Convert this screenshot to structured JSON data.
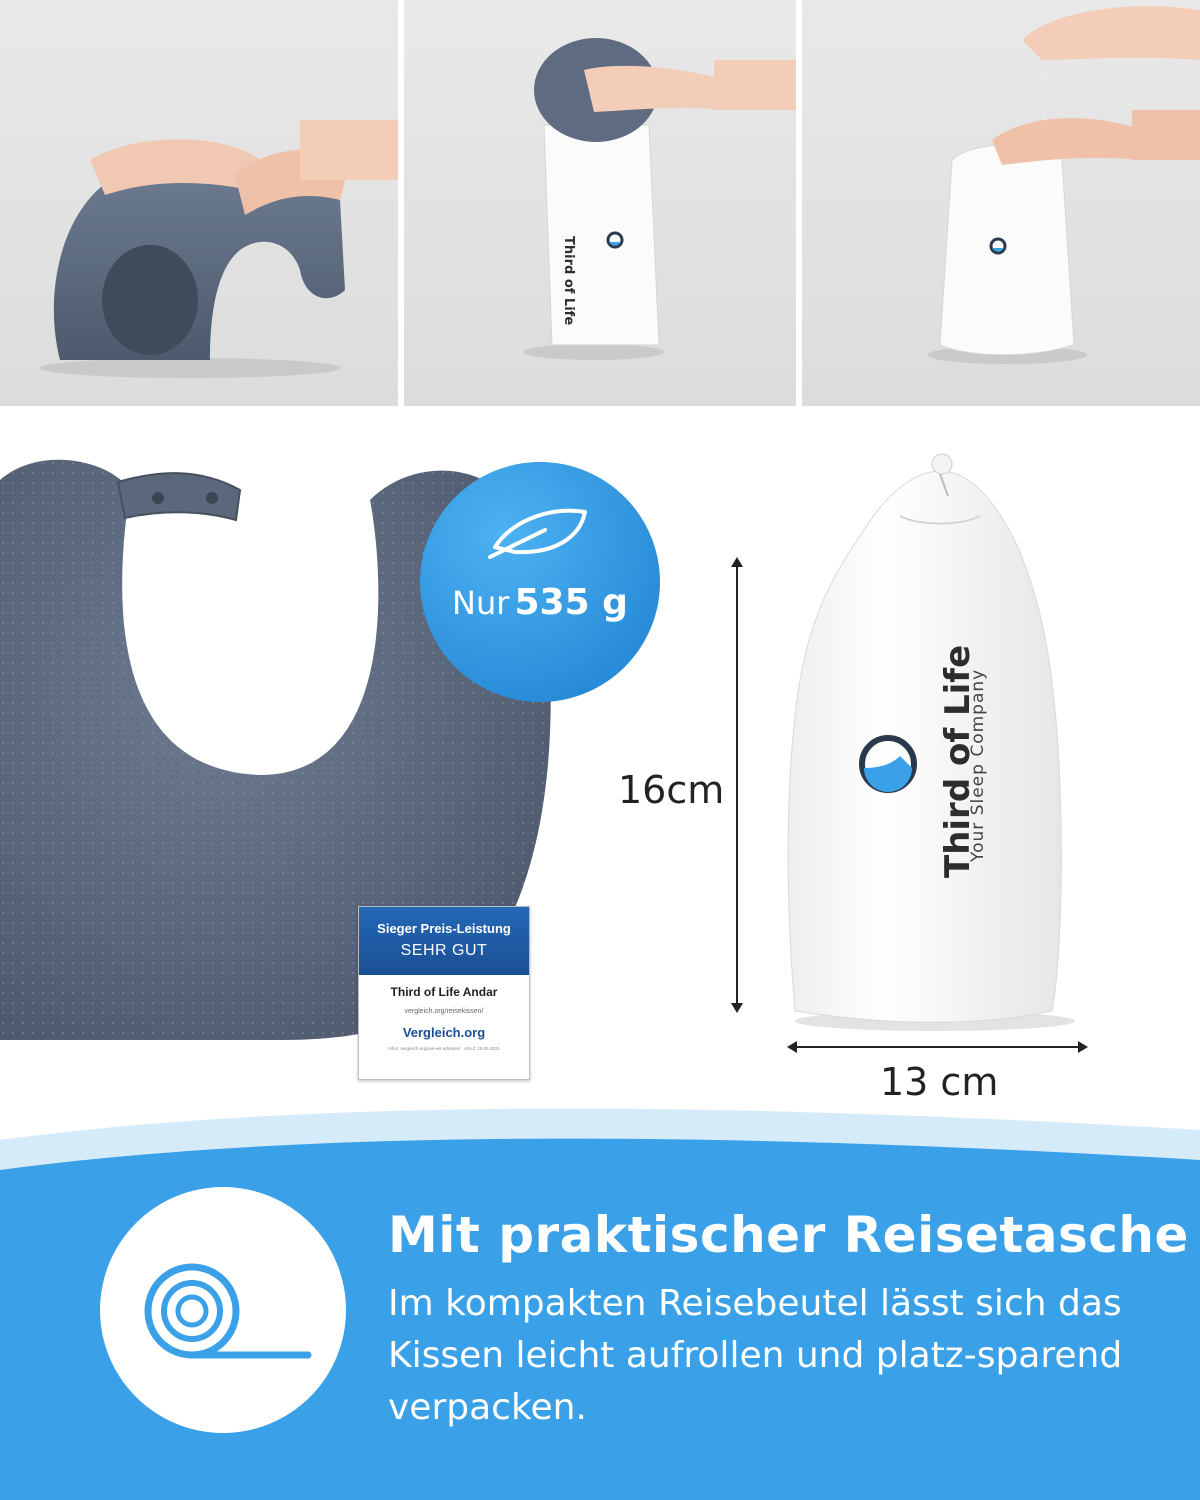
{
  "weight_badge": {
    "prefix": "Nur",
    "value": "535 g",
    "icon": "feather-icon"
  },
  "dimensions": {
    "height": "16cm",
    "width": "13 cm"
  },
  "bag_brand": {
    "name": "Third of Life",
    "tagline": "Your Sleep Company"
  },
  "small_bag_brand": {
    "name": "Third of Life",
    "tagline": "Your Sleep Company"
  },
  "award": {
    "title": "Sieger Preis-Leistung",
    "grade": "SEHR GUT",
    "product": "Third of Life Andar",
    "url": "vergleich.org/reisekissen/",
    "brand": "Vergleich.org",
    "info": "Infos: vergleich.org/wie-wir-arbeiten/ · Abruf: 19.05.2021"
  },
  "feature": {
    "icon": "roll-icon",
    "headline": "Mit praktischer Reisetasche",
    "description": "Im kompakten Reisebeutel lässt sich das Kissen leicht aufrollen und platz-sparend verpacken."
  },
  "colors": {
    "accent_blue": "#3aa0e8",
    "light_blue": "#d6ebfa",
    "pillow_gray": "#5f6b80"
  }
}
